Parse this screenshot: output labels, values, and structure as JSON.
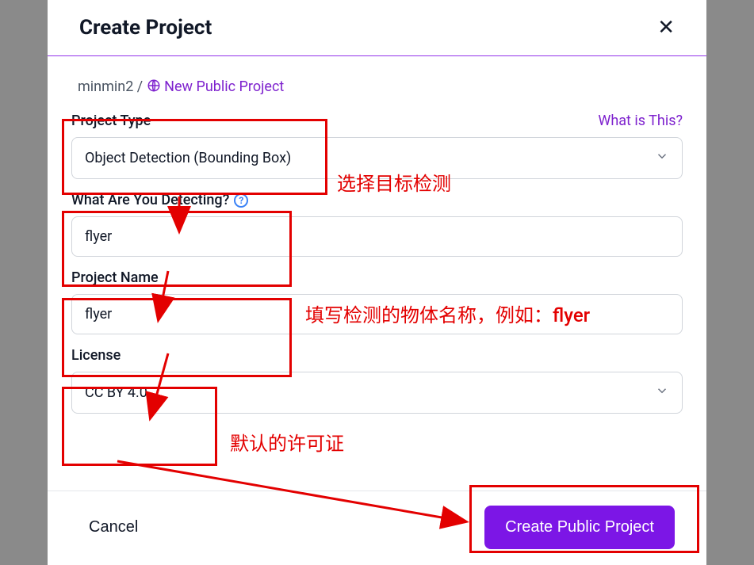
{
  "header": {
    "title": "Create Project"
  },
  "breadcrumb": {
    "workspace": "minmin2",
    "slash": " / ",
    "new_project": "New Public Project"
  },
  "fields": {
    "project_type": {
      "label": "Project Type",
      "help": "What is This?",
      "value": "Object Detection (Bounding Box)"
    },
    "detecting": {
      "label": "What Are You Detecting?",
      "value": "flyer"
    },
    "project_name": {
      "label": "Project Name",
      "value": "flyer"
    },
    "license": {
      "label": "License",
      "value": "CC BY 4.0"
    }
  },
  "footer": {
    "cancel": "Cancel",
    "create": "Create Public Project"
  },
  "annotations": {
    "obj_detect": "选择目标检测",
    "detect_name": "填写检测的物体名称，例如：flyer",
    "license_default": "默认的许可证"
  }
}
